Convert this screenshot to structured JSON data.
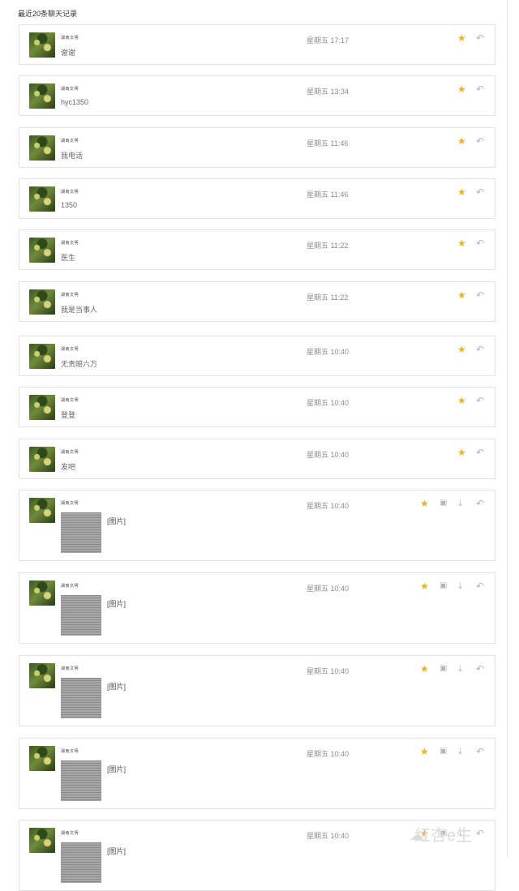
{
  "page": {
    "title": "最近20条聊天记录"
  },
  "messages": [
    {
      "sender": "湖南文明",
      "time": "星期五 17:17",
      "text": "谢谢",
      "image": false
    },
    {
      "sender": "湖南文明",
      "time": "星期五 13:34",
      "text": "hyc1350",
      "image": false
    },
    {
      "sender": "湖南文明",
      "time": "星期五 11:46",
      "text": "我电话",
      "image": false
    },
    {
      "sender": "湖南文明",
      "time": "星期五 11:46",
      "text": "1350",
      "image": false
    },
    {
      "sender": "湖南文明",
      "time": "星期五 11:22",
      "text": "医生",
      "image": false
    },
    {
      "sender": "湖南文明",
      "time": "星期五 11:22",
      "text": "我是当事人",
      "image": false
    },
    {
      "sender": "湖南文明",
      "time": "星期五 10:40",
      "text": "无责赔六万",
      "image": false
    },
    {
      "sender": "湖南文明",
      "time": "星期五 10:40",
      "text": "登登",
      "image": false
    },
    {
      "sender": "湖南文明",
      "time": "星期五 10:40",
      "text": "发吧",
      "image": false
    },
    {
      "sender": "湖南文明",
      "time": "星期五 10:40",
      "text": "[图片]",
      "image": true
    },
    {
      "sender": "湖南文明",
      "time": "星期五 10:40",
      "text": "[图片]",
      "image": true
    },
    {
      "sender": "湖南文明",
      "time": "星期五 10:40",
      "text": "[图片]",
      "image": true
    },
    {
      "sender": "湖南文明",
      "time": "星期五 10:40",
      "text": "[图片]",
      "image": true
    },
    {
      "sender": "湖南文明",
      "time": "星期五 10:40",
      "text": "[图片]",
      "image": true
    }
  ],
  "icons": {
    "star": "star-icon",
    "reply": "reply-icon",
    "save": "save-icon",
    "download": "download-icon"
  },
  "colors": {
    "star": "#e8b32a",
    "border": "#e2e2e2"
  },
  "watermark": {
    "text": "红杏e生"
  }
}
